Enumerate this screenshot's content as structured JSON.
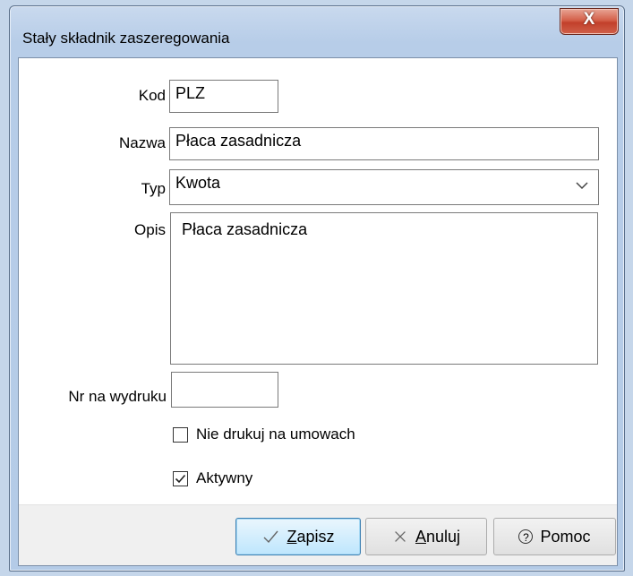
{
  "window": {
    "title": "Stały składnik zaszeregowania",
    "close_label": "X"
  },
  "form": {
    "kod_label": "Kod",
    "kod_value": "PLZ",
    "nazwa_label": "Nazwa",
    "nazwa_value": "Płaca zasadnicza",
    "typ_label": "Typ",
    "typ_value": "Kwota",
    "opis_label": "Opis",
    "opis_value": "Płaca zasadnicza",
    "nr_label": "Nr na wydruku",
    "nr_value": "",
    "nie_drukuj_label": "Nie drukuj na umowach",
    "nie_drukuj_checked": false,
    "aktywny_label": "Aktywny",
    "aktywny_checked": true
  },
  "buttons": {
    "zapisz_first": "Z",
    "zapisz_rest": "apisz",
    "anuluj_first": "A",
    "anuluj_rest": "nuluj",
    "pomoc": "Pomoc"
  },
  "icons": {
    "zapisz": "checkmark-icon",
    "anuluj": "x-icon",
    "pomoc": "help-circle-icon"
  }
}
